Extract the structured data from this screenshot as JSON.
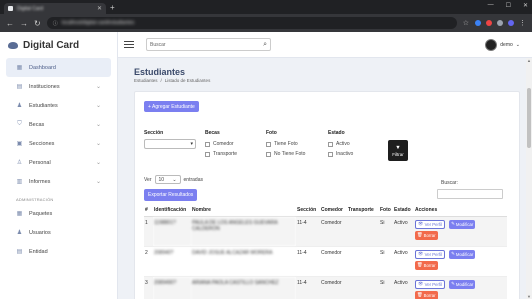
{
  "browser": {
    "tab_title": "Digital Card",
    "url": "localhost/digital-card/estudiantes"
  },
  "brand": {
    "name": "Digital Card"
  },
  "sidebar": {
    "items": [
      {
        "label": "Dashboard",
        "icon": "dashboard-icon"
      },
      {
        "label": "Instituciones",
        "icon": "institution-icon"
      },
      {
        "label": "Estudiantes",
        "icon": "students-icon"
      },
      {
        "label": "Becas",
        "icon": "scholarship-icon"
      },
      {
        "label": "Secciones",
        "icon": "sections-icon"
      },
      {
        "label": "Personal",
        "icon": "staff-icon"
      },
      {
        "label": "Informes",
        "icon": "reports-icon"
      }
    ],
    "section_label": "ADMINISTRACIÓN",
    "admin_items": [
      {
        "label": "Paquetes",
        "icon": "packages-icon"
      },
      {
        "label": "Usuarios",
        "icon": "users-icon"
      },
      {
        "label": "Entidad",
        "icon": "entity-icon"
      }
    ]
  },
  "topbar": {
    "search_placeholder": "Buscar",
    "username": "demo"
  },
  "page": {
    "title": "Estudiantes",
    "breadcrumb": [
      "Estudiantes",
      "Listado de Estudiantes"
    ]
  },
  "actions": {
    "add_label": "+ Agregar Estudiante",
    "export_label": "Exportar Resultados",
    "filter_label": "Filtrar"
  },
  "filters": {
    "seccion_title": "Sección",
    "becas_title": "Becas",
    "becas_options": [
      "Comedor",
      "Transporte"
    ],
    "foto_title": "Foto",
    "foto_options": [
      "Tiene Foto",
      "No Tiene Foto"
    ],
    "estado_title": "Estado",
    "estado_options": [
      "Activo",
      "Inactivo"
    ]
  },
  "table_controls": {
    "show_label": "Ver",
    "page_size": "10",
    "entries_label": "entradas",
    "search_label": "Buscar:"
  },
  "table": {
    "headers": [
      "#",
      "Identificación",
      "Nombre",
      "Sección",
      "Comedor",
      "Transporte",
      "Foto",
      "Estado",
      "Acciones"
    ],
    "rows": [
      {
        "n": "1",
        "id": "1198801?",
        "name": "PAULA DE LOS ANGELES GUEVARA CALDERON",
        "seccion": "11-4",
        "comedor": "Comedor",
        "transporte": "",
        "foto": "Si",
        "estado": "Activo"
      },
      {
        "n": "2",
        "id": "208940?",
        "name": "DAVID JOSUE ALCAZAR MORERA",
        "seccion": "11-4",
        "comedor": "Comedor",
        "transporte": "",
        "foto": "Si",
        "estado": "Activo"
      },
      {
        "n": "3",
        "id": "2089490?",
        "name": "ARIANA PAOLA CASTILLO SANCHEZ",
        "seccion": "11-4",
        "comedor": "Comedor",
        "transporte": "",
        "foto": "Si",
        "estado": "Activo"
      }
    ],
    "btn_ver": "Ver Perfil",
    "btn_mod": "Modificar",
    "btn_del": "Borrar"
  }
}
